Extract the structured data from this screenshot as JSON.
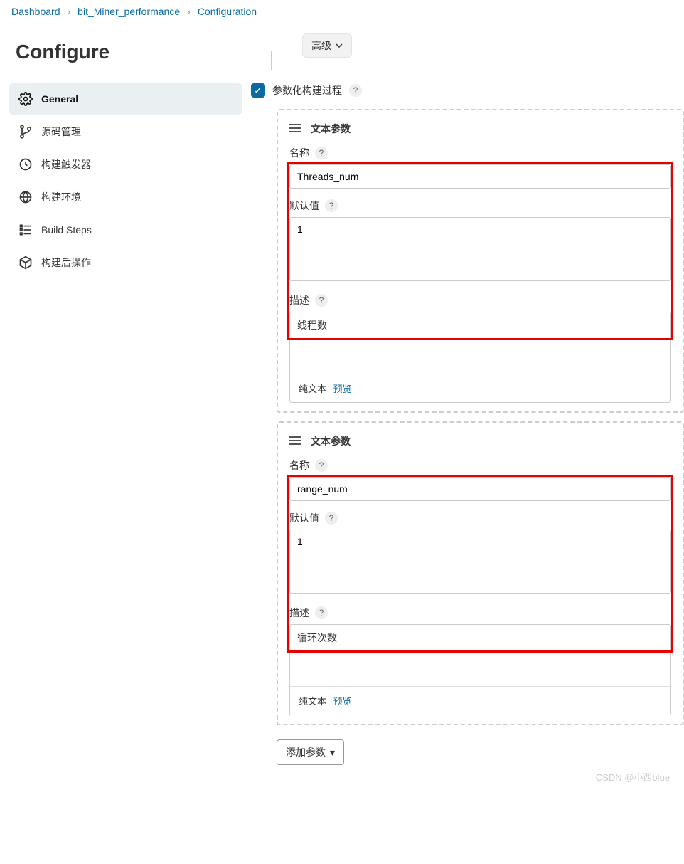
{
  "breadcrumb": {
    "item0": "Dashboard",
    "item1": "bit_Miner_performance",
    "item2": "Configuration"
  },
  "page_title": "Configure",
  "nav": {
    "general": "General",
    "scm": "源码管理",
    "triggers": "构建触发器",
    "env": "构建环境",
    "steps": "Build Steps",
    "post": "构建后操作"
  },
  "advanced_btn": "高级",
  "section": {
    "param_build": "参数化构建过程"
  },
  "param_type_label": "文本参数",
  "labels": {
    "name": "名称",
    "default": "默认值",
    "desc": "描述",
    "plain_text": "纯文本",
    "preview": "预览"
  },
  "params": [
    {
      "name": "Threads_num",
      "default": "1",
      "desc": "线程数"
    },
    {
      "name": "range_num",
      "default": "1",
      "desc": "循环次数"
    }
  ],
  "add_param_btn": "添加参数",
  "watermark": "CSDN @小西blue"
}
